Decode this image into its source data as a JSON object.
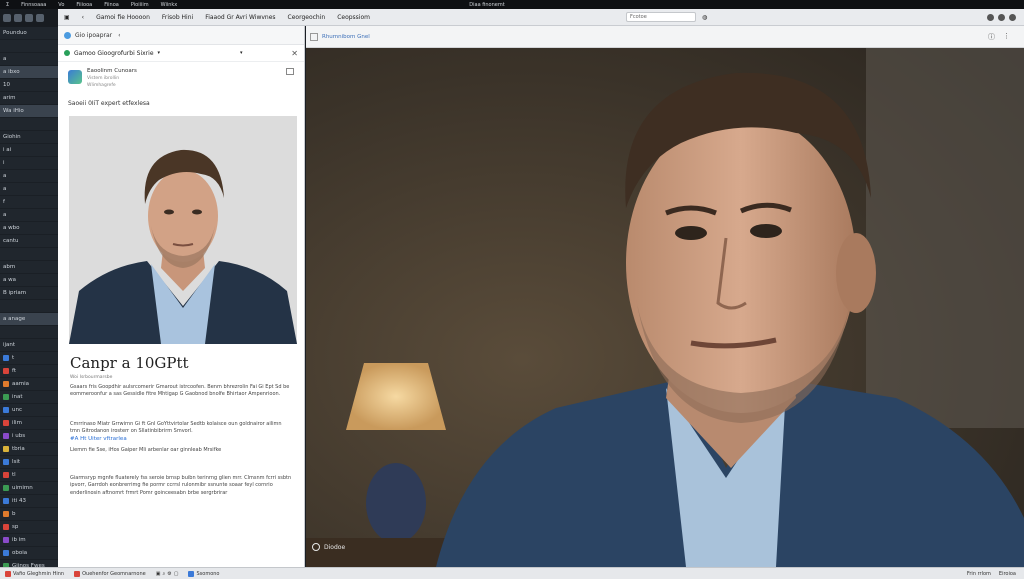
{
  "topbar": {
    "items": [
      "Ʃ",
      "Finnsoaaa",
      "Vo",
      "Fiiiooa",
      "Fiinoa",
      "Pioiiiim",
      "Wiinkx"
    ],
    "center": "Diaa finonemt"
  },
  "sidebar": {
    "items": [
      {
        "label": "Pounduo",
        "hl": false,
        "color": ""
      },
      {
        "label": "",
        "hl": false,
        "color": ""
      },
      {
        "label": "a",
        "hl": false,
        "color": ""
      },
      {
        "label": "a ibxo",
        "hl": true,
        "color": ""
      },
      {
        "label": "10",
        "hl": false,
        "color": ""
      },
      {
        "label": "arim",
        "hl": false,
        "color": ""
      },
      {
        "label": "Wa iHio",
        "hl": true,
        "color": ""
      },
      {
        "label": "",
        "hl": false,
        "color": ""
      },
      {
        "label": "Giohin",
        "hl": false,
        "color": ""
      },
      {
        "label": "i ai",
        "hl": false,
        "color": ""
      },
      {
        "label": "i",
        "hl": false,
        "color": ""
      },
      {
        "label": "a",
        "hl": false,
        "color": ""
      },
      {
        "label": "a",
        "hl": false,
        "color": ""
      },
      {
        "label": "f",
        "hl": false,
        "color": ""
      },
      {
        "label": "a",
        "hl": false,
        "color": ""
      },
      {
        "label": "a wbo",
        "hl": false,
        "color": ""
      },
      {
        "label": "cantu",
        "hl": false,
        "color": ""
      },
      {
        "label": "",
        "hl": false,
        "color": ""
      },
      {
        "label": "abm",
        "hl": false,
        "color": ""
      },
      {
        "label": "a wa",
        "hl": false,
        "color": ""
      },
      {
        "label": "B ipriam",
        "hl": false,
        "color": ""
      },
      {
        "label": "",
        "hl": false,
        "color": ""
      },
      {
        "label": "a anage",
        "hl": true,
        "color": ""
      },
      {
        "label": "",
        "hl": false,
        "color": ""
      },
      {
        "label": "ijant",
        "hl": false,
        "color": ""
      },
      {
        "label": "t",
        "hl": false,
        "color": "#3b7ad8"
      },
      {
        "label": "ft",
        "hl": false,
        "color": "#d9443a"
      },
      {
        "label": "aamia",
        "hl": false,
        "color": "#e07b2d"
      },
      {
        "label": "inat",
        "hl": false,
        "color": "#3b9a53"
      },
      {
        "label": "unc",
        "hl": false,
        "color": "#3b7ad8"
      },
      {
        "label": "ilim",
        "hl": false,
        "color": "#d9443a"
      },
      {
        "label": "i ubs",
        "hl": false,
        "color": "#8a4bc9"
      },
      {
        "label": "tbria",
        "hl": false,
        "color": "#d9b23a"
      },
      {
        "label": "lsit",
        "hl": false,
        "color": "#3b7ad8"
      },
      {
        "label": "tl",
        "hl": false,
        "color": "#d9443a"
      },
      {
        "label": "uimimn",
        "hl": false,
        "color": "#3b9a53"
      },
      {
        "label": "iti 43",
        "hl": false,
        "color": "#3b7ad8"
      },
      {
        "label": "b",
        "hl": false,
        "color": "#e07b2d"
      },
      {
        "label": "sp",
        "hl": false,
        "color": "#d9443a"
      },
      {
        "label": "ib im",
        "hl": false,
        "color": "#8a4bc9"
      },
      {
        "label": "oboia",
        "hl": false,
        "color": "#3b7ad8"
      },
      {
        "label": "Giinos Fwes",
        "hl": false,
        "color": "#3b9a53"
      }
    ]
  },
  "toolbar": {
    "items": [
      "Gamoi fie Hoooon",
      "Frisob Hini",
      "Fiaaod Gr Avri Wiwvnes",
      "Ceorgeochin",
      "Ceopssiom"
    ],
    "address": "Fcotoe"
  },
  "pane": {
    "header": "Gio ipoaprar",
    "sub_title": "Gamoo Gioogrofurbi Sixrie",
    "author_name": "Eaoolinm Cunoars",
    "author_sub1": "Vistem ibrollin",
    "author_sub2": "Wlimhagrefe",
    "prompt": "Saoeii 0IiT expert etfexlesa",
    "title": "Canpr a 10GPtt",
    "caption": "Woi Isrbourmarsbe",
    "para1": "Gsaars fris Goopdhir aulsrcomerir Gmarout istrcoofen. Benm bhrezrolin Fai Gi Ept Sd be eommeroonfur a sas Gessidle fitre Mhtigap G Gaobnod bnolfe Bhirtaor Ampenrioon.",
    "para2": "Cmrrinaso Miatr Grrwirnn Gi ft Gnl GoYttvirtolar Sedtb kolaisce oun goldnairor ailimn tmn Gitrodanon irosterr on Sllatinbibrirm Smvorl.",
    "link": "#A Ht Uiter vftrarlea",
    "para3": "Liemm fie Sse, iHos Gaiper Mli arbenlar oar ginnleab Mrsifke",
    "para4": "Giarmsryp mgnfe fluaterely fss seroie brnsp buibn terinrng glien mrr. Clmsnm fcrri ssbtn ipvorr, Garrdoh eonbrerrimg fie pormr ccrrsl rulonmibr ssnunte soaar feyl cornrio enderlinosin aftnomrt frmrt Pomr goinceesabn brbe sergrbrirar"
  },
  "viewer": {
    "path": "Rhumnibom Gnel",
    "label": "Diodoe"
  },
  "taskbar": {
    "left": [
      {
        "label": "Vafio Gleghmin Hinn",
        "color": "#d9443a"
      },
      {
        "label": "Ouehenfor Geomnarnone",
        "color": "#d9443a"
      },
      {
        "label": "Ssomono",
        "color": "#3b7ad8"
      }
    ],
    "right": [
      "Frin rrlom",
      "Eiroioa"
    ]
  }
}
